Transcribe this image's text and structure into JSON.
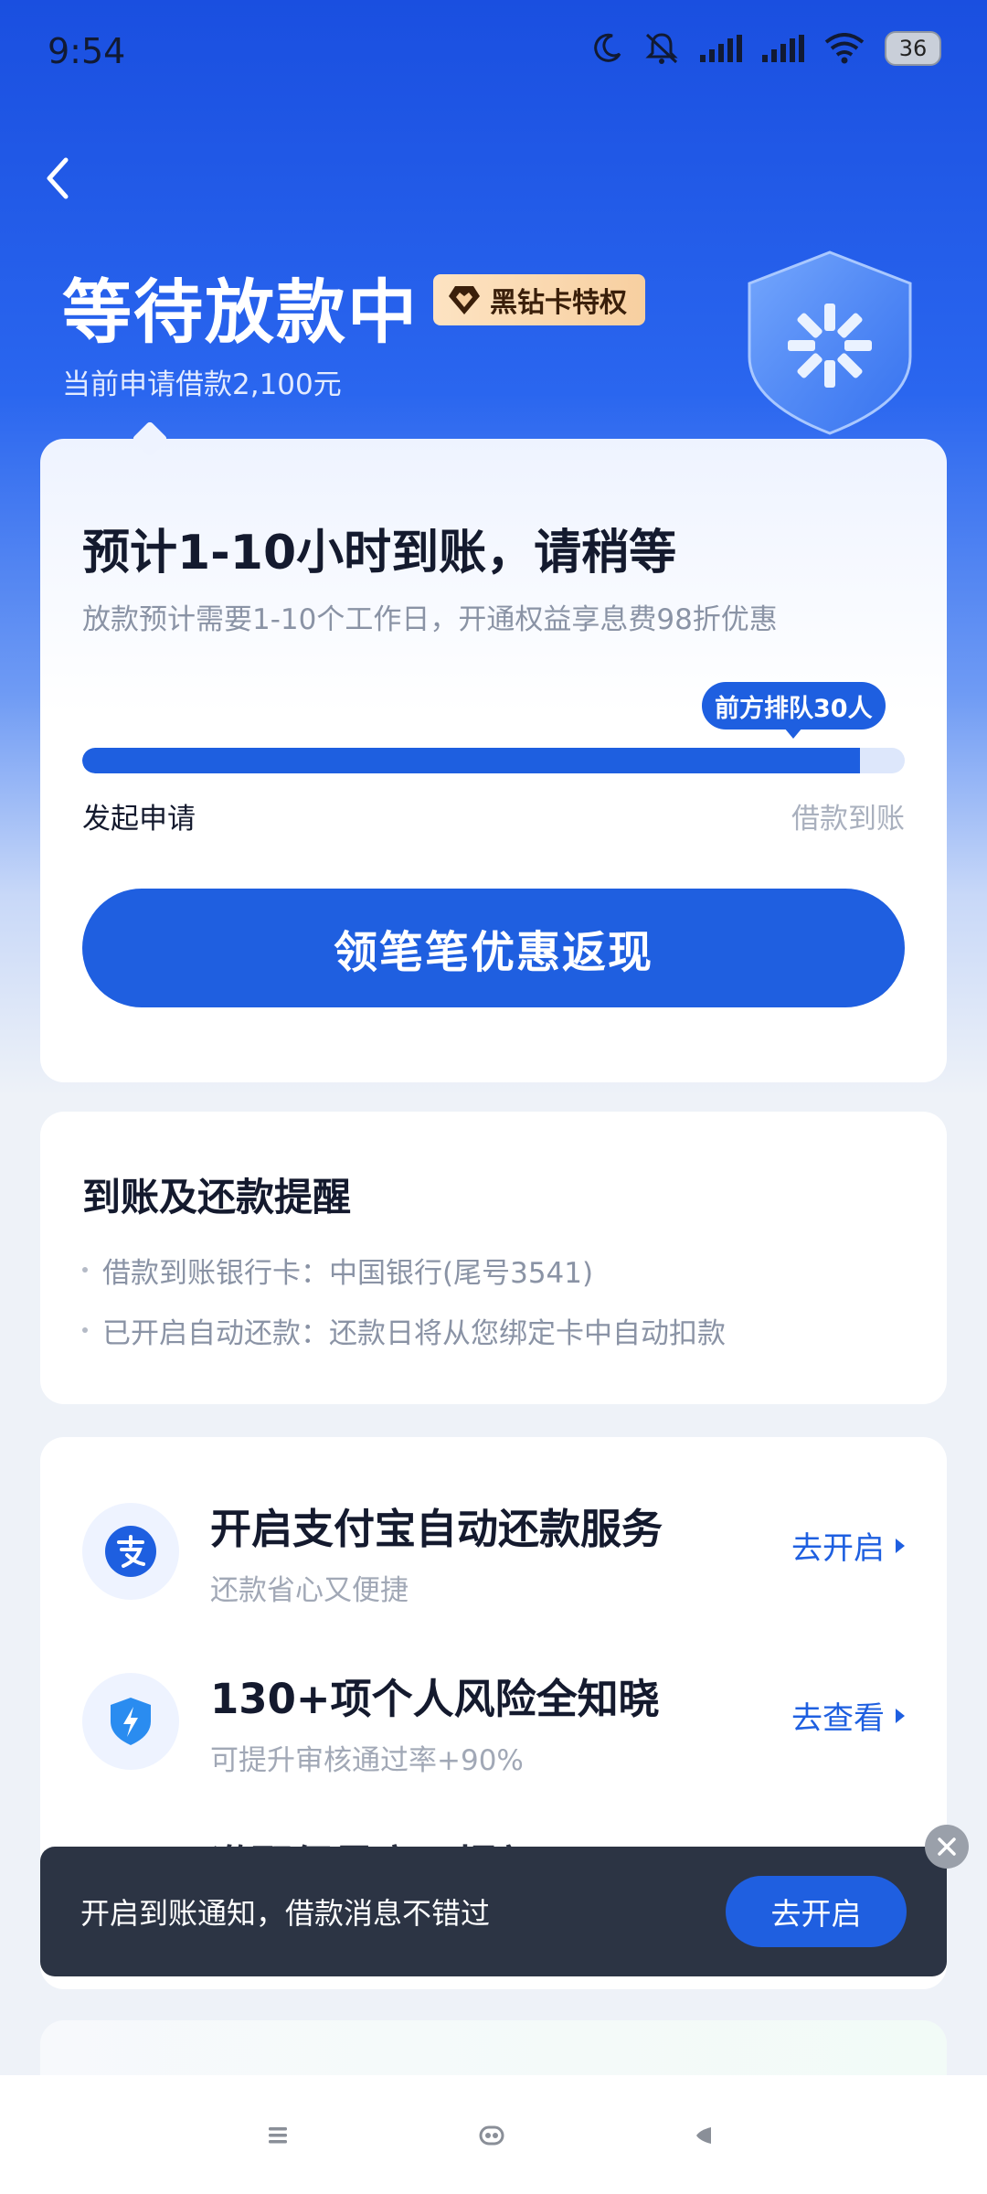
{
  "status_bar": {
    "time": "9:54",
    "battery": "36"
  },
  "header": {
    "title": "等待放款中",
    "badge": "黑钻卡特权",
    "subtitle": "当前申请借款2,100元"
  },
  "progress_card": {
    "eta_title": "预计1-10小时到账，请稍等",
    "eta_desc": "放款预计需要1-10个工作日，开通权益享息费98折优惠",
    "queue_badge": "前方排队30人",
    "progress_fraction": 0.945,
    "start_label": "发起申请",
    "end_label": "借款到账",
    "cta_label": "领笔笔优惠返现"
  },
  "reminder_card": {
    "title": "到账及还款提醒",
    "items": [
      "借款到账银行卡：中国银行(尾号3541)",
      "已开启自动还款：还款日将从您绑定卡中自动扣款"
    ]
  },
  "services": [
    {
      "icon": "alipay-icon",
      "title": "开启支付宝自动还款服务",
      "subtitle": "还款省心又便捷",
      "action": "去开启"
    },
    {
      "icon": "shield-bolt-icon",
      "title": "130+项个人风险全知晓",
      "subtitle": "可提升审核通过率+90%",
      "action": "去查看"
    },
    {
      "icon": "",
      "title": "邀配偶最高可提额9600元",
      "subtitle": "",
      "action": ""
    }
  ],
  "toast": {
    "text": "开启到账通知，借款消息不错过",
    "button": "去开启"
  },
  "colors": {
    "primary": "#1f5fe0",
    "header_top": "#1a4fe0",
    "toast_bg": "#2c3444"
  }
}
